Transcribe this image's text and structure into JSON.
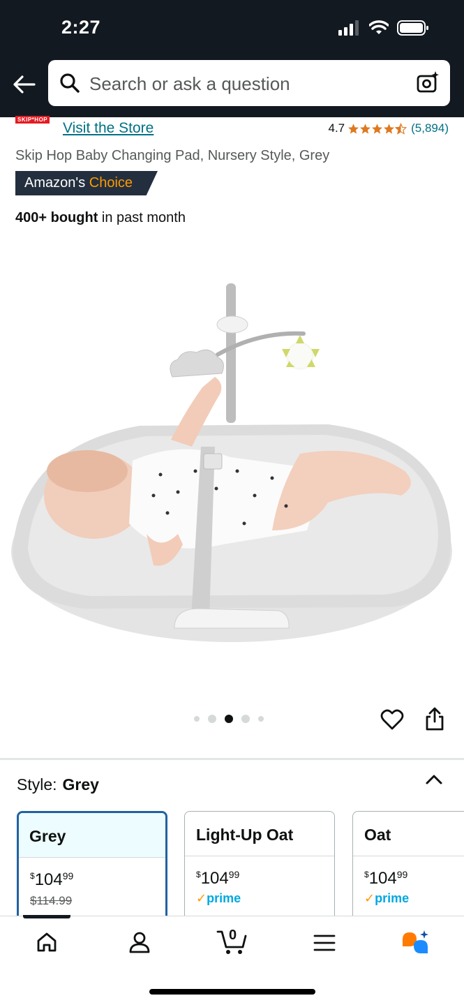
{
  "status_bar": {
    "time": "2:27"
  },
  "search": {
    "placeholder": "Search or ask a question"
  },
  "store": {
    "logo_text": "SKIP*HOP",
    "link_label": "Visit the Store",
    "rating_value": "4.7",
    "rating_stars": 4.5,
    "rating_count": "(5,894)"
  },
  "product": {
    "title": "Skip Hop Baby Changing Pad, Nursery Style, Grey",
    "badge_prefix": "Amazon's ",
    "badge_highlight": "Choice",
    "bought_bold": "400+ bought",
    "bought_rest": " in past month",
    "image_icon": "product-photo",
    "gallery_current": 3,
    "gallery_count": 5
  },
  "style": {
    "label": "Style:",
    "selected": "Grey",
    "variants": [
      {
        "name": "Grey",
        "price_sym": "$",
        "price_whole": "104",
        "price_cents": "99",
        "list_price": "$114.99",
        "prime": false,
        "selected": true
      },
      {
        "name": "Light-Up Oat",
        "price_sym": "$",
        "price_whole": "104",
        "price_cents": "99",
        "list_price": "",
        "prime": true,
        "prime_label": "prime",
        "selected": false
      },
      {
        "name": "Oat",
        "price_sym": "$",
        "price_whole": "104",
        "price_cents": "99",
        "list_price": "",
        "prime": true,
        "prime_label": "prime",
        "selected": false
      }
    ]
  },
  "bottom_nav": {
    "cart_count": "0",
    "items": [
      "home-icon",
      "account-icon",
      "cart-icon",
      "menu-icon",
      "rufus-icon"
    ]
  },
  "colors": {
    "header_bg": "#131921",
    "link": "#007185",
    "star": "#de7921",
    "choice_badge_bg": "#232f3e",
    "choice_highlight": "#ff9900",
    "selected_border": "#2162a1",
    "prime_blue": "#00a8e1"
  }
}
